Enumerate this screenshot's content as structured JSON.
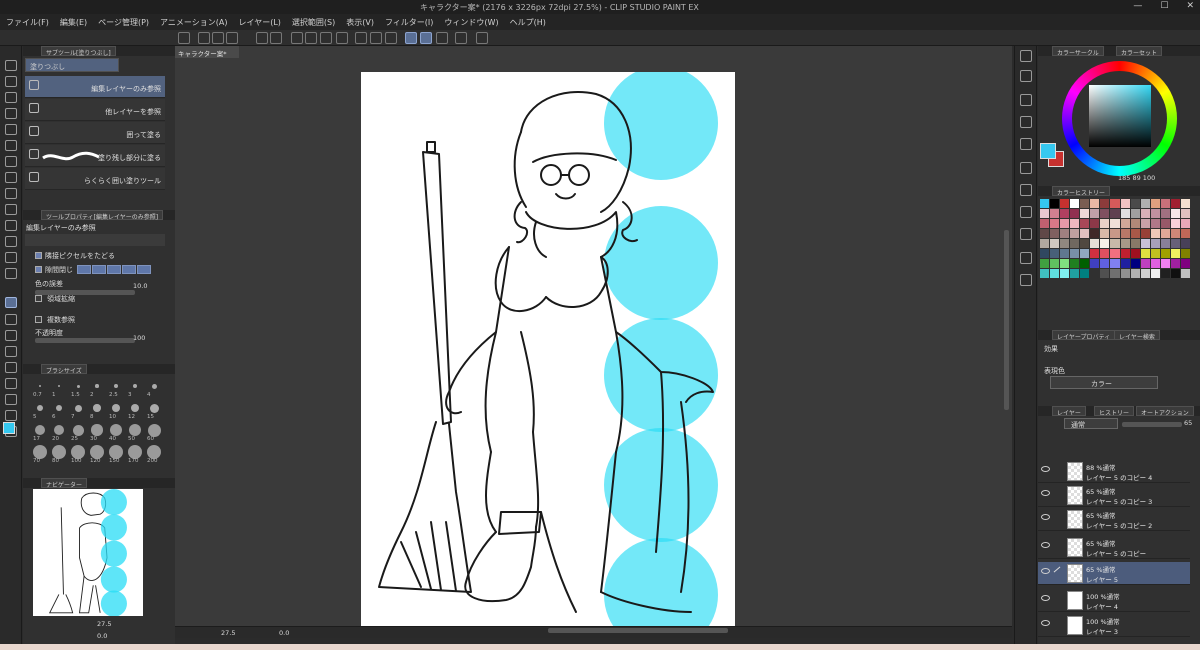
{
  "window": {
    "title": "キャラクター案* (2176 x 3226px 72dpi 27.5%) - CLIP STUDIO PAINT EX",
    "controls": [
      "—",
      "☐",
      "✕"
    ]
  },
  "menu": [
    "ファイル(F)",
    "編集(E)",
    "ページ管理(P)",
    "アニメーション(A)",
    "レイヤー(L)",
    "選択範囲(S)",
    "表示(V)",
    "フィルター(I)",
    "ウィンドウ(W)",
    "ヘルプ(H)"
  ],
  "subtool_panel": {
    "tab_label": "サブツール[塗りつぶし]",
    "group_label": "塗りつぶし",
    "items": [
      {
        "label": "編集レイヤーのみ参照",
        "active": true
      },
      {
        "label": "他レイヤーを参照",
        "active": false
      },
      {
        "label": "囲って塗る",
        "active": false
      },
      {
        "label": "塗り残し部分に塗る",
        "active": false
      },
      {
        "label": "らくらく囲い塗りツール",
        "active": false
      }
    ]
  },
  "tool_property": {
    "tab_label": "ツールプロパティ[編集レイヤーのみ参照]",
    "name": "編集レイヤーのみ参照",
    "adjacent_pixels": "隣接ピクセルをたどる",
    "close_gap": "隙間閉じ",
    "color_margin": "色の誤差",
    "color_margin_value": "10.0",
    "area_scaling": "領域拡縮",
    "multi_refer": "複数参照",
    "opacity": "不透明度",
    "opacity_value": "100"
  },
  "brush_size": {
    "tab_label": "ブラシサイズ",
    "sizes": [
      "0.7",
      "1",
      "1.5",
      "2",
      "2.5",
      "3",
      "4",
      "5",
      "6",
      "7",
      "8",
      "10",
      "12",
      "15",
      "17",
      "20",
      "25",
      "30",
      "40",
      "50",
      "60",
      "70",
      "80",
      "100",
      "120",
      "150",
      "170",
      "200"
    ]
  },
  "navigator": {
    "tab_label": "ナビゲーター",
    "zoom": "27.5",
    "rotation": "0.0"
  },
  "canvas": {
    "tab_label": "キャラクター案*",
    "zoom": "27.5",
    "rotation": "0.0"
  },
  "color_circle": {
    "tab_label": "カラーサークル",
    "tab2_label": "カラーセット",
    "hsv": "185  89  100",
    "foreground": "#35c8f0",
    "background": "#c7312f"
  },
  "color_history": {
    "tab_label": "カラーヒストリー",
    "colors": [
      "#35c8f0",
      "#000000",
      "#c7312f",
      "#ffffff",
      "#7a5d52",
      "#e8b7a4",
      "#8d3b3b",
      "#d45a5a",
      "#f2c4c4",
      "#4a4a4a",
      "#b0b0b0",
      "#e0a080",
      "#c8707a",
      "#a02030",
      "#f5e0d0",
      "#e8c8d0",
      "#d08090",
      "#b04060",
      "#903050",
      "#f0d8d8",
      "#c0a0a8",
      "#805060",
      "#604050",
      "#e0e0e0",
      "#a0a0a0",
      "#d8b0b8",
      "#c090a0",
      "#a07080",
      "#f8e8e8",
      "#e0c0c0",
      "#c06070",
      "#d87888",
      "#e898a8",
      "#f0b8c0",
      "#a84858",
      "#8c3848",
      "#e8d0c8",
      "#f0e0d8",
      "#d0a898",
      "#b08878",
      "#c8a0a8",
      "#b07888",
      "#985868",
      "#f8d0d8",
      "#e8a8b8",
      "#604848",
      "#806060",
      "#a08080",
      "#c0a0a0",
      "#e0c0c0",
      "#402828",
      "#d8b8a8",
      "#c89888",
      "#b87868",
      "#a85848",
      "#984038",
      "#f0c8b8",
      "#e0a898",
      "#d08878",
      "#c06858",
      "#b0a8a0",
      "#d0c8c0",
      "#908880",
      "#706860",
      "#504840",
      "#e8e0d8",
      "#f8f0e8",
      "#c8b8a8",
      "#a89888",
      "#887868",
      "#c8c0d8",
      "#a8a0b8",
      "#888098",
      "#686078",
      "#484058",
      "#304860",
      "#486078",
      "#607890",
      "#7890a8",
      "#90a8c0",
      "#d03040",
      "#e05060",
      "#f07080",
      "#c02030",
      "#a01020",
      "#e0e040",
      "#c0c020",
      "#a0a000",
      "#f0f060",
      "#808000",
      "#40a040",
      "#60c060",
      "#80e080",
      "#208020",
      "#006000",
      "#4040c0",
      "#6060e0",
      "#8080f0",
      "#2020a0",
      "#000080",
      "#c040c0",
      "#e060e0",
      "#f080f0",
      "#a020a0",
      "#800080",
      "#40c0c0",
      "#60e0e0",
      "#80f0f0",
      "#20a0a0",
      "#008080",
      "#303030",
      "#505050",
      "#707070",
      "#909090",
      "#b0b0b0",
      "#d0d0d0",
      "#f0f0f0",
      "#202020",
      "#101010",
      "#c0c0c0"
    ]
  },
  "layer_property": {
    "tab_label": "レイヤープロパティ",
    "tab2_label": "レイヤー検索",
    "effect_label": "効果",
    "expression_label": "表現色",
    "expression_value": "カラー"
  },
  "layer_panel": {
    "tab_label": "レイヤー",
    "tab2_label": "ヒストリー",
    "tab3_label": "オートアクション",
    "blend_mode": "通常",
    "opacity": "65",
    "layers": [
      {
        "mode": "88 %通常",
        "name": "レイヤー 5 のコピー 4",
        "selected": false
      },
      {
        "mode": "65 %通常",
        "name": "レイヤー 5 のコピー 3",
        "selected": false
      },
      {
        "mode": "65 %通常",
        "name": "レイヤー 5 のコピー 2",
        "selected": false
      },
      {
        "mode": "65 %通常",
        "name": "レイヤー 5 のコピー",
        "selected": false
      },
      {
        "mode": "65 %通常",
        "name": "レイヤー 5",
        "selected": true
      },
      {
        "mode": "100 %通常",
        "name": "レイヤー 4",
        "selected": false
      },
      {
        "mode": "100 %通常",
        "name": "レイヤー 3",
        "selected": false
      }
    ]
  },
  "icons": {
    "toolbox": [
      "magnifier-icon",
      "hand-icon",
      "rotate-icon",
      "selection-icon",
      "auto-select-icon",
      "move-icon",
      "eyedropper-icon",
      "pen-icon",
      "pencil-icon",
      "brush-icon",
      "airbrush-icon",
      "decoration-icon",
      "eraser-icon",
      "blend-icon",
      "fill-icon",
      "gradient-icon",
      "figure-icon",
      "frame-icon",
      "ruler-icon",
      "text-icon",
      "balloon-icon",
      "correct-line-icon",
      "lasso-icon"
    ]
  }
}
